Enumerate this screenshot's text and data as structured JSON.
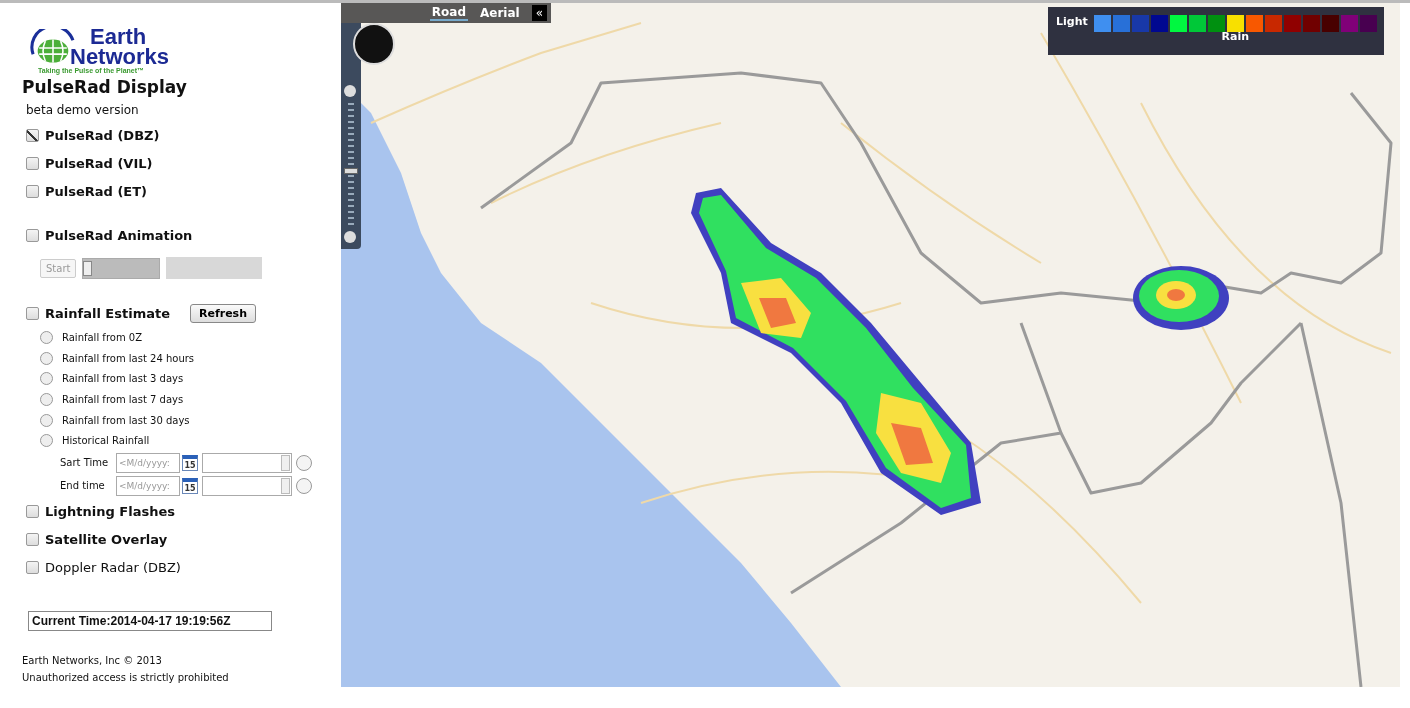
{
  "logo": {
    "line1": "Earth",
    "line2": "Networks",
    "tagline": "Taking the Pulse of the Planet™"
  },
  "title": "PulseRad Display",
  "subtitle": "beta demo version",
  "layers": [
    {
      "kind": "checkbox",
      "label": "PulseRad (DBZ)",
      "checked": true
    },
    {
      "kind": "checkbox",
      "label": "PulseRad (VIL)",
      "checked": false
    },
    {
      "kind": "checkbox",
      "label": "PulseRad (ET)",
      "checked": false
    },
    {
      "kind": "animation",
      "label": "PulseRad Animation",
      "checked": false,
      "button": "Start",
      "disabled": true,
      "level": 0
    },
    {
      "kind": "rainfall",
      "label": "Rainfall Estimate",
      "checked": false,
      "button": "Refresh",
      "options": [
        {
          "label": "Rainfall from 0Z",
          "selected": false
        },
        {
          "label": "Rainfall from last 24 hours",
          "selected": false
        },
        {
          "label": "Rainfall from last 3 days",
          "selected": false
        },
        {
          "label": "Rainfall from last 7 days",
          "selected": false
        },
        {
          "label": "Rainfall from last 30 days",
          "selected": false
        },
        {
          "label": "Historical Rainfall",
          "selected": false
        }
      ],
      "times": [
        {
          "label": "Sart Time",
          "placeholder": "<M/d/yyyy:",
          "calendar_day": "15"
        },
        {
          "label": "End time",
          "placeholder": "<M/d/yyyy:",
          "calendar_day": "15"
        }
      ]
    },
    {
      "kind": "checkbox",
      "label": "Lightning Flashes",
      "checked": false
    },
    {
      "kind": "checkbox",
      "label": "Satellite Overlay",
      "checked": false
    },
    {
      "kind": "plain",
      "label": "Doppler Radar (DBZ)",
      "checked": false
    }
  ],
  "current_time": "Current Time:2014-04-17 19:19:56Z",
  "footer": [
    "Earth Networks, Inc © 2013",
    "Unauthorized access is strictly prohibited"
  ],
  "map": {
    "map_types": [
      {
        "label": "Road",
        "selected": true
      },
      {
        "label": "Aerial",
        "selected": false
      }
    ],
    "collapse": "«",
    "zoom": {
      "level": 0.42
    },
    "legend": {
      "label": "Light",
      "caption": "Rain",
      "swatches": [
        {
          "color": "#3f8ff0"
        },
        {
          "color": "#2870d8"
        },
        {
          "color": "#1838a8"
        },
        {
          "color": "#000890"
        },
        {
          "color": "#00f840"
        },
        {
          "color": "#00c838"
        },
        {
          "color": "#009010"
        },
        {
          "color": "#f8e000"
        },
        {
          "color": "#f85800"
        },
        {
          "color": "#c82800"
        },
        {
          "color": "#900000"
        },
        {
          "color": "#700000"
        },
        {
          "color": "#480000"
        },
        {
          "color": "#800078"
        },
        {
          "color": "#480050"
        }
      ]
    }
  }
}
